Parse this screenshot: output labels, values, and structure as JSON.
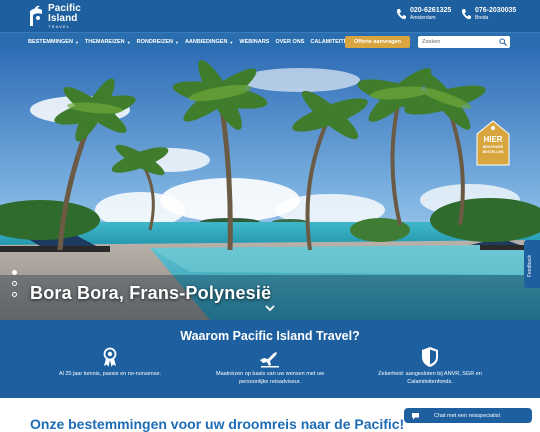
{
  "header": {
    "logo": {
      "line1": "Pacific",
      "line2": "Island",
      "line3": "TRAVEL"
    },
    "phones": [
      {
        "number": "020-6261325",
        "city": "Amsterdam"
      },
      {
        "number": "076-2030035",
        "city": "Breda"
      }
    ]
  },
  "nav": {
    "items": [
      {
        "label": "BESTEMMINGEN",
        "dropdown": true
      },
      {
        "label": "THEMAREIZEN",
        "dropdown": true
      },
      {
        "label": "RONDREIZEN",
        "dropdown": true
      },
      {
        "label": "AANBIEDINGEN",
        "dropdown": true
      },
      {
        "label": "WEBINARS",
        "dropdown": false
      },
      {
        "label": "OVER ONS",
        "dropdown": false
      },
      {
        "label": "CALAMITEITEN",
        "dropdown": false
      }
    ],
    "offer_button": "Offerte aanvragen",
    "search_placeholder": "Zoeken"
  },
  "hero": {
    "title": "Bora Bora, Frans-Polynesië",
    "slides_total": 3,
    "active_slide": 1,
    "badge": {
      "top": "HIER",
      "bottom_line1": "BROCHURE",
      "bottom_line2": "BESTELLEN"
    },
    "feedback_label": "Feedback"
  },
  "why": {
    "title": "Waarom Pacific Island Travel?",
    "items": [
      {
        "icon": "award-icon",
        "text_line1": "Al 25 jaar kennis, passie en no-nonsense.",
        "text_line2": ""
      },
      {
        "icon": "airplane-icon",
        "text_line1": "Maatreizen op basis van uw wensen met uw",
        "text_line2": "persoonlijke reisadviseur."
      },
      {
        "icon": "shield-icon",
        "text_line1": "Zekerheid: aangesloten bij ANVR, SGR en",
        "text_line2": "Calamiteitenfonds."
      }
    ]
  },
  "destinations": {
    "title": "Onze bestemmingen voor uw droomreis naar de Pacific!"
  },
  "chat": {
    "label": "Chat met een reisspecialist"
  },
  "colors": {
    "primary": "#1d5f9f",
    "nav": "#2a6eb0",
    "accent": "#d8a53f",
    "heading": "#1d6cb5"
  }
}
